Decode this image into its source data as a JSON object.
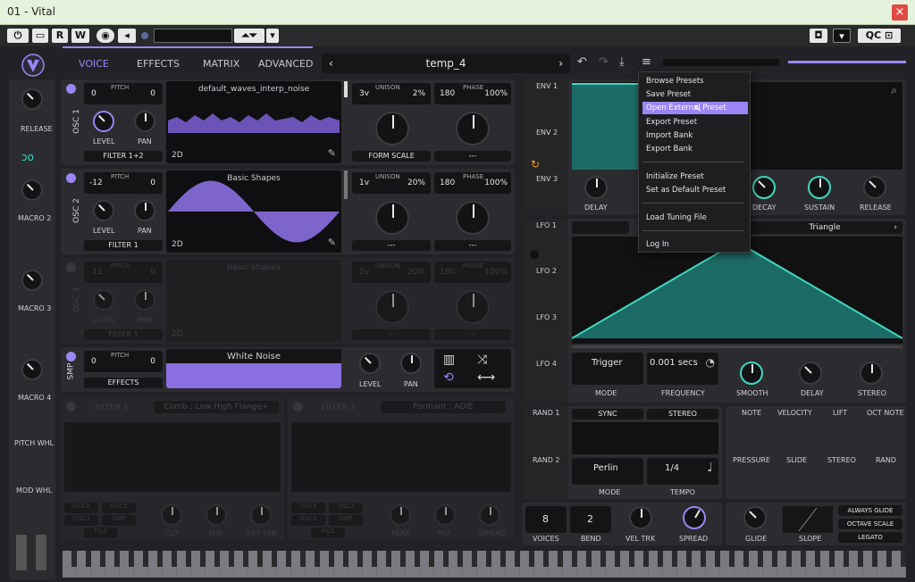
{
  "window": {
    "title": "01 - Vital",
    "close": "×"
  },
  "host": {
    "r": "R",
    "w": "W",
    "qc": "QC"
  },
  "nav": {
    "tabs": [
      "VOICE",
      "EFFECTS",
      "MATRIX",
      "ADVANCED"
    ],
    "preset": "temp_4"
  },
  "osc1": {
    "label": "OSC 1",
    "pitch_label": "PITCH",
    "pitch_left": "0",
    "pitch_right": "0",
    "wave": "default_waves_interp_noise",
    "level": "LEVEL",
    "pan": "PAN",
    "filter": "FILTER 1+2",
    "twod": "2D",
    "unison_label": "UNISON",
    "unison_voices": "3v",
    "unison_pct": "2%",
    "phase_label": "PHASE",
    "phase_val": "180",
    "phase_pct": "100%",
    "form": "FORM SCALE",
    "dash": "---"
  },
  "osc2": {
    "label": "OSC 2",
    "pitch_label": "PITCH",
    "pitch_left": "-12",
    "pitch_right": "0",
    "wave": "Basic Shapes",
    "level": "LEVEL",
    "pan": "PAN",
    "filter": "FILTER 1",
    "twod": "2D",
    "unison_label": "UNISON",
    "unison_voices": "1v",
    "unison_pct": "20%",
    "phase_label": "PHASE",
    "phase_val": "180",
    "phase_pct": "100%",
    "dash": "---",
    "dash2": "---"
  },
  "osc3": {
    "label": "OSC 3",
    "pitch_label": "PITCH",
    "pitch_left": "-12",
    "pitch_right": "0",
    "wave": "Basic Shapes",
    "level": "LEVEL",
    "pan": "PAN",
    "filter": "FILTER 1",
    "twod": "2D",
    "unison_label": "UNISON",
    "unison_voices": "1v",
    "unison_pct": "20%",
    "phase_label": "PHASE",
    "phase_val": "180",
    "phase_pct": "100%",
    "dash": "---",
    "dash2": "---"
  },
  "smp": {
    "label": "SMP",
    "pitch_label": "PITCH",
    "pitch_left": "0",
    "pitch_right": "0",
    "sample": "White Noise",
    "effects": "EFFECTS",
    "level": "LEVEL",
    "pan": "PAN"
  },
  "macros": {
    "release": "RELEASE",
    "m2": "MACRO 2",
    "m3": "MACRO 3",
    "m4": "MACRO 4",
    "pitch": "PITCH WHL",
    "mod": "MOD WHL"
  },
  "filters": {
    "f1": "FILTER 1",
    "f1type": "Comb : Low High Flange+",
    "f2": "FILTER 2",
    "f2type": "Formant : AOIE",
    "osc1": "OSC1",
    "osc2": "OSC2",
    "osc3": "OSC3",
    "smp": "SMP",
    "fil2": "FIL2",
    "fil1": "FIL1",
    "cut": "CUT",
    "mix": "MIX",
    "keytrk": "KEY TRK",
    "peak": "PEAK",
    "spread": "SPREAD"
  },
  "env": {
    "tabs": [
      "ENV 1",
      "ENV 2",
      "ENV 3"
    ],
    "knobs": [
      "DELAY",
      "DECAY",
      "SUSTAIN",
      "RELEASE"
    ]
  },
  "lfo": {
    "tabs": [
      "LFO 1",
      "LFO 2",
      "LFO 3",
      "LFO 4"
    ],
    "shape": "Triangle",
    "mode_val": "Trigger",
    "mode": "MODE",
    "freq_val": "0.001 secs",
    "freq": "FREQUENCY",
    "smooth": "SMOOTH",
    "delay": "DELAY",
    "stereo": "STEREO"
  },
  "rand": {
    "tabs": [
      "RAND 1",
      "RAND 2"
    ],
    "sync": "SYNC",
    "stereo": "STEREO",
    "mode_val": "Perlin",
    "mode": "MODE",
    "tempo_val": "1/4",
    "tempo": "TEMPO"
  },
  "mods": {
    "row1": [
      "NOTE",
      "VELOCITY",
      "LIFT",
      "OCT NOTE"
    ],
    "row2": [
      "PRESSURE",
      "SLIDE",
      "STEREO",
      "RAND"
    ]
  },
  "voice": {
    "voices_val": "8",
    "voices": "VOICES",
    "bend_val": "2",
    "bend": "BEND",
    "veltrk": "VEL TRK",
    "spread": "SPREAD",
    "glide": "GLIDE",
    "slope": "SLOPE",
    "always": "ALWAYS GLIDE",
    "octave": "OCTAVE SCALE",
    "legato": "LEGATO"
  },
  "menu": {
    "items": [
      "Browse Presets",
      "Save Preset",
      "Open External Preset",
      "Export Preset",
      "Import Bank",
      "Export Bank",
      "Initialize Preset",
      "Set as Default Preset",
      "Load Tuning File",
      "Log In"
    ]
  },
  "colors": {
    "accent": "#9c85f5",
    "teal": "#3fd9c0",
    "bg": "#222226",
    "title_bg": "#e6f3dc"
  }
}
